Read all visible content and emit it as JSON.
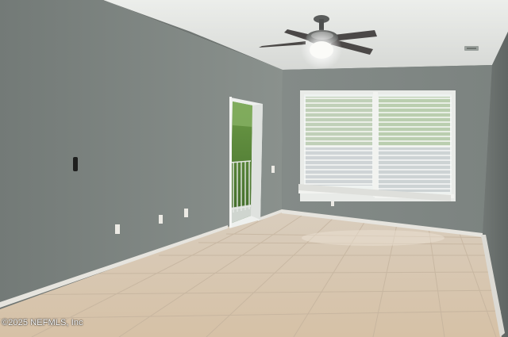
{
  "photo": {
    "subject": "empty-room-interior",
    "watermark": "©2025 NEFMLS, Inc",
    "colors": {
      "wall_left": "#7b827e",
      "wall_back": "#838a87",
      "wall_right": "#6d7371",
      "ceiling": "#e7e8e5",
      "floor_tile": "#d9c8b3",
      "baseboard": "#e9e7e1",
      "window_light": "#eef2f0",
      "foliage": "#5c8a3a"
    }
  }
}
